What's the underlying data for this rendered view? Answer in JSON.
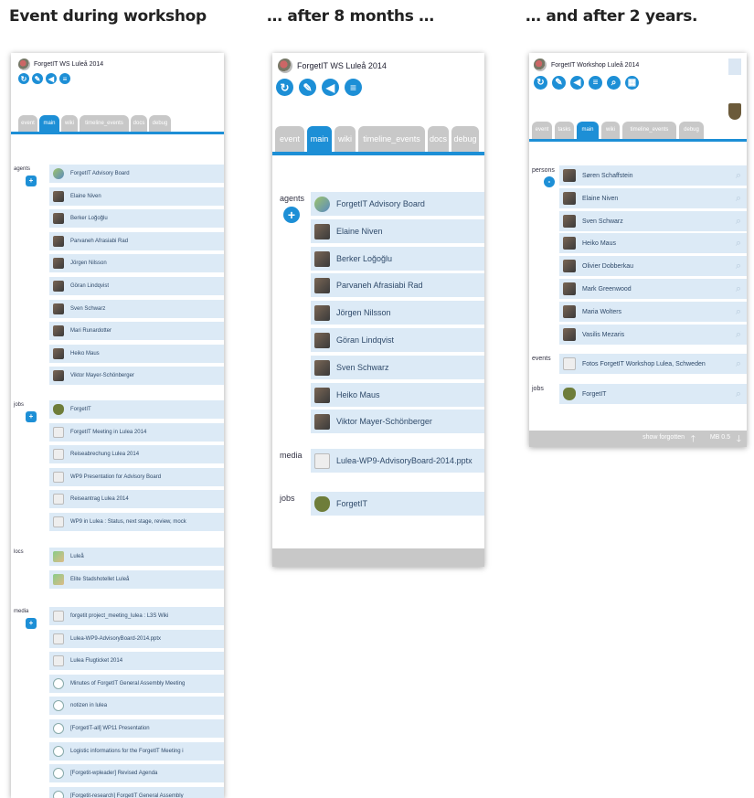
{
  "headings": [
    "Event during workshop",
    "… after 8 months …",
    "… and after 2 years."
  ],
  "p1": {
    "title": "ForgetIT WS Luleå 2014",
    "tabs": [
      "event",
      "main",
      "wiki",
      "timeline_events",
      "docs",
      "debug"
    ],
    "active_tab": "main",
    "sections": [
      {
        "label": "agents",
        "items": [
          "ForgetIT Advisory Board",
          "Elaine Niven",
          "Berker Loğoğlu",
          "Parvaneh Afrasiabi Rad",
          "Jörgen Nilsson",
          "Göran Lindqvist",
          "Sven Schwarz",
          "Mari Runardotter",
          "Heiko Maus",
          "Viktor Mayer-Schönberger"
        ]
      },
      {
        "label": "jobs",
        "items": [
          "ForgetIT",
          "ForgetIT Meeting in Lulea 2014",
          "Reiseabrechung Lulea 2014",
          "WP9 Presentation for Advisory Board",
          "Reiseantrag Lulea 2014",
          "WP9 in Lulea : Status, next stage, review, mock"
        ]
      },
      {
        "label": "locs",
        "items": [
          "Luleå",
          "Elite Stadshotellet Luleå"
        ]
      },
      {
        "label": "media",
        "items": [
          "forgetit project_meeting_lulea : L3S Wiki",
          "Lulea-WP9-AdvisoryBoard-2014.pptx",
          "Lulea Flugticket 2014",
          "Minutes of ForgetIT General Assembly Meeting",
          "notizen in lulea",
          "[ForgetIT-all] WP11 Presentation",
          "Logistic informations for the ForgetIT Meeting i",
          "[Forgetit-wpleader] Revised Agenda",
          "[Forgetit-research] ForgetIT General Assembly"
        ]
      }
    ]
  },
  "p2": {
    "title": "ForgetIT WS Luleå 2014",
    "tabs": [
      "event",
      "main",
      "wiki",
      "timeline_events",
      "docs",
      "debug"
    ],
    "active_tab": "main",
    "sections": [
      {
        "label": "agents",
        "items": [
          "ForgetIT Advisory Board",
          "Elaine Niven",
          "Berker Loğoğlu",
          "Parvaneh Afrasiabi Rad",
          "Jörgen Nilsson",
          "Göran Lindqvist",
          "Sven Schwarz",
          "Heiko Maus",
          "Viktor Mayer-Schönberger"
        ]
      },
      {
        "label": "media",
        "items": [
          "Lulea-WP9-AdvisoryBoard-2014.pptx"
        ]
      },
      {
        "label": "jobs",
        "items": [
          "ForgetIT"
        ]
      }
    ]
  },
  "p3": {
    "title": "ForgetIT Workshop Luleå 2014",
    "tabs": [
      "event",
      "tasks",
      "main",
      "wiki",
      "timeline_events",
      "debug"
    ],
    "active_tab": "main",
    "sections": [
      {
        "label": "persons",
        "items": [
          "Søren Schaffstein",
          "Elaine Niven",
          "Sven Schwarz",
          "Heiko Maus",
          "Olivier Dobberkau",
          "Mark Greenwood",
          "Maria Wolters",
          "Vasilis Mezaris"
        ]
      },
      {
        "label": "events",
        "items": [
          "Fotos ForgetIT Workshop Lulea, Schweden"
        ]
      },
      {
        "label": "jobs",
        "items": [
          "ForgetIT"
        ]
      }
    ],
    "footer": {
      "show_forgotten": "show forgotten",
      "mb": "MB 0.5"
    }
  },
  "icons": {
    "add": "+",
    "collapse": "-",
    "search": "search-icon"
  }
}
